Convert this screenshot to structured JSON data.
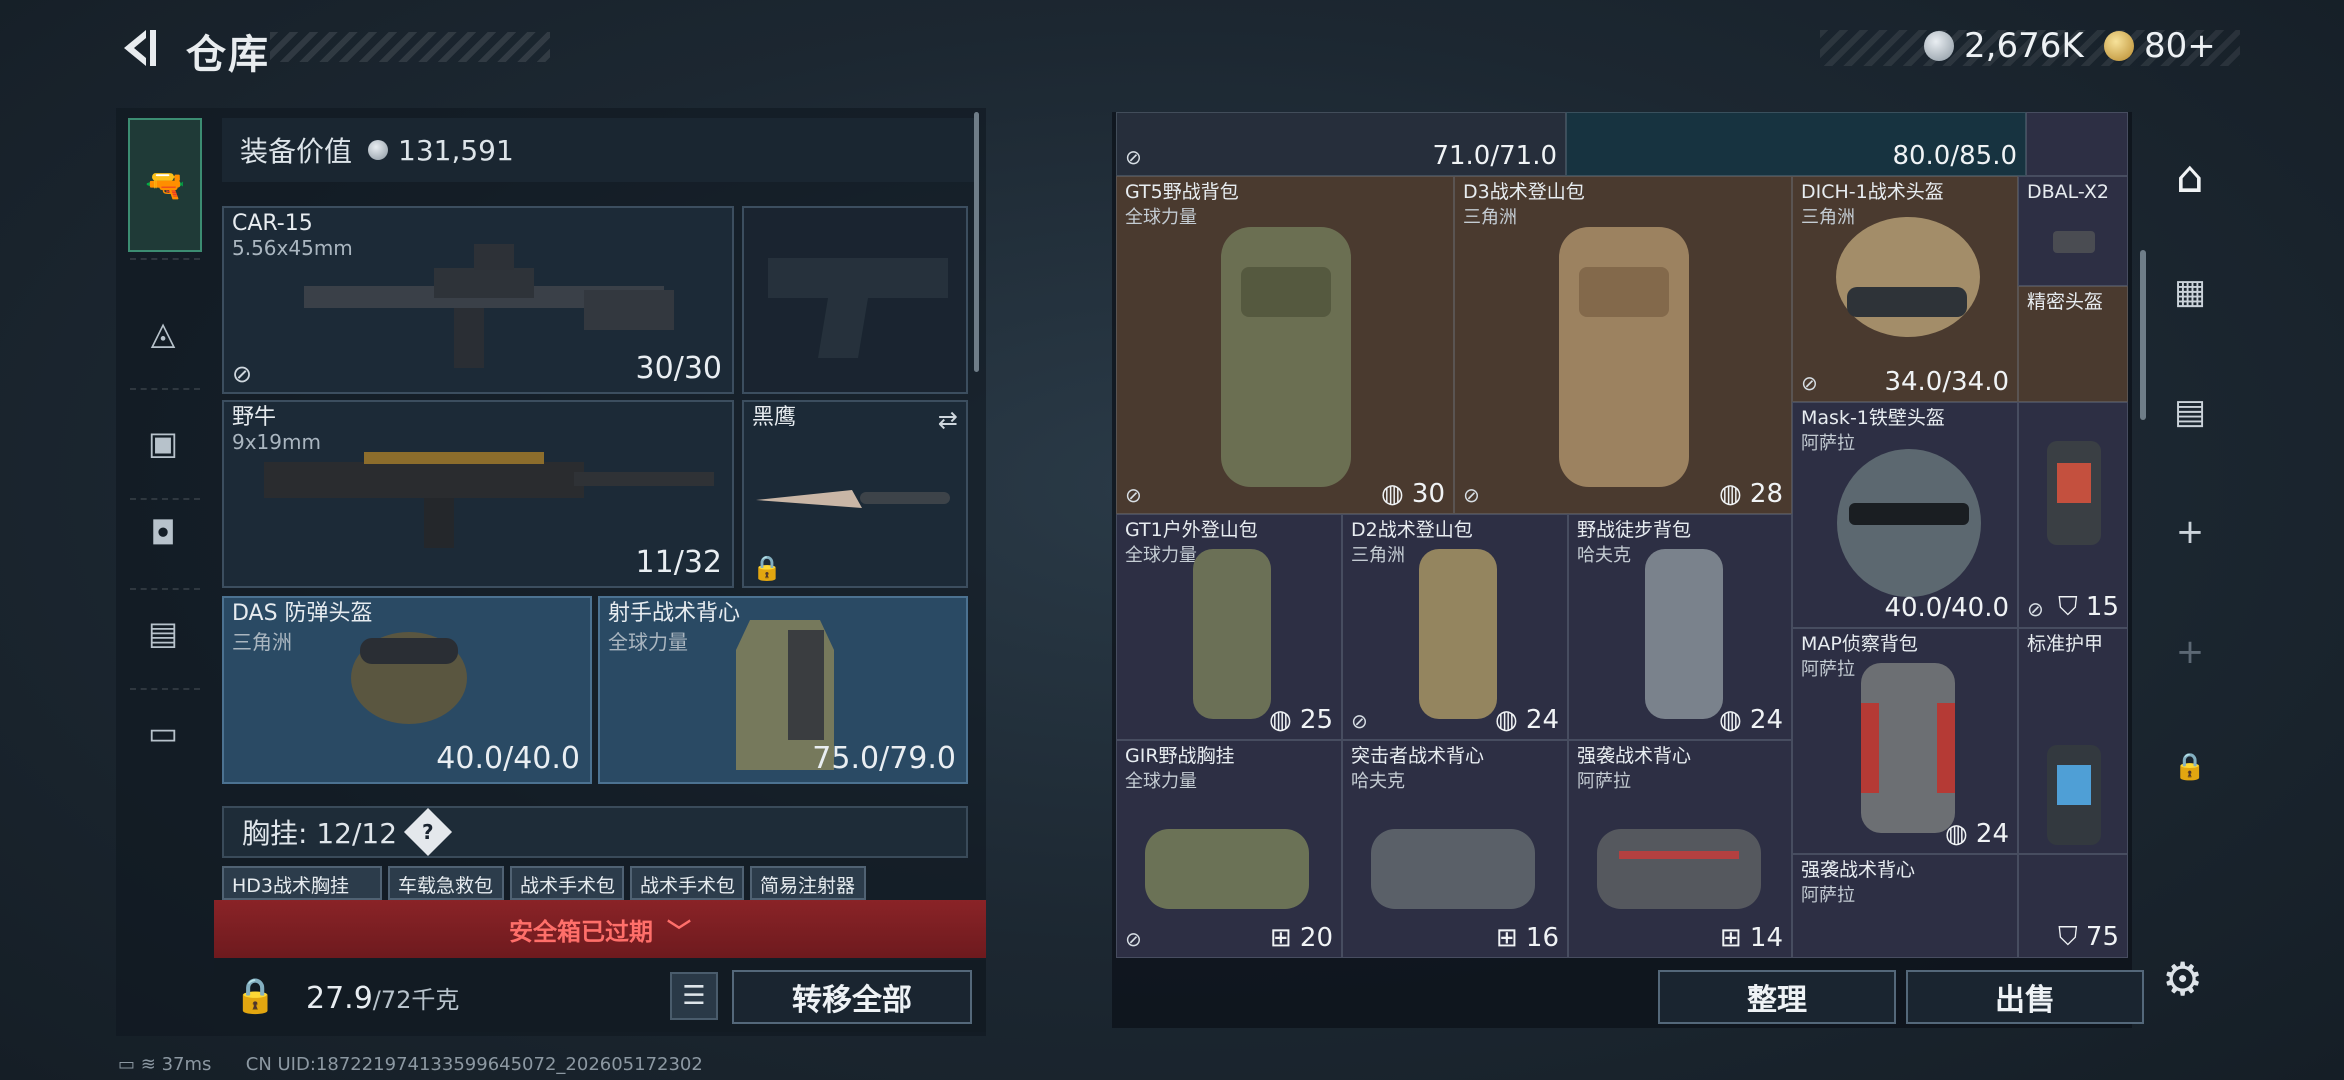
{
  "header": {
    "title": "仓库",
    "currency_silver": "2,676K",
    "currency_gold": "80+"
  },
  "left": {
    "equip_label": "装备价值",
    "equip_value": "131,591",
    "slots": [
      {
        "name": "CAR-15",
        "sub": "5.56x45mm",
        "value": "30/30"
      },
      {
        "name": "野牛",
        "sub": "9x19mm",
        "value": "11/32"
      },
      {
        "name": "黑鹰"
      },
      {
        "name": "DAS 防弹头盔",
        "sub": "三角洲",
        "value": "40.0/40.0"
      },
      {
        "name": "射手战术背心",
        "sub": "全球力量",
        "value": "75.0/79.0"
      }
    ],
    "chest_label": "胸挂: 12/12",
    "tags": [
      "HD3战术胸挂",
      "车载急救包",
      "战术手术包",
      "战术手术包",
      "简易注射器"
    ],
    "alert": "安全箱已过期",
    "weight": "27.9",
    "weight_unit": "/72千克",
    "transfer_all": "转移全部"
  },
  "grid": {
    "top_values": [
      "71.0/71.0",
      "80.0/85.0"
    ],
    "items": [
      {
        "name": "GT5野战背包",
        "sub": "全球力量",
        "value": "30"
      },
      {
        "name": "D3战术登山包",
        "sub": "三角洲",
        "value": "28"
      },
      {
        "name": "DICH-1战术头盔",
        "sub": "三角洲",
        "value": "34.0/34.0"
      },
      {
        "name": "DBAL-X2",
        "sub": ""
      },
      {
        "name": "精密头盔",
        "sub": ""
      },
      {
        "name": "Mask-1铁壁头盔",
        "sub": "阿萨拉",
        "value": "40.0/40.0",
        "extra": "15"
      },
      {
        "name": "GT1户外登山包",
        "sub": "全球力量",
        "value": "25"
      },
      {
        "name": "D2战术登山包",
        "sub": "三角洲",
        "value": "24"
      },
      {
        "name": "野战徒步背包",
        "sub": "哈夫克",
        "value": "24"
      },
      {
        "name": "MAP侦察背包",
        "sub": "阿萨拉",
        "value": "24"
      },
      {
        "name": "标准护甲",
        "sub": ""
      },
      {
        "name": "GIR野战胸挂",
        "sub": "全球力量",
        "value": "20"
      },
      {
        "name": "突击者战术背心",
        "sub": "哈夫克",
        "value": "16"
      },
      {
        "name": "强袭战术背心",
        "sub": "阿萨拉",
        "value": "14"
      },
      {
        "name": "强袭战术背心",
        "sub": "阿萨拉",
        "value": "75"
      }
    ],
    "sort_btn": "整理",
    "sell_btn": "出售"
  },
  "status": {
    "ping": "37ms",
    "uid": "CN UID:187221974133599645072_202605172302"
  }
}
